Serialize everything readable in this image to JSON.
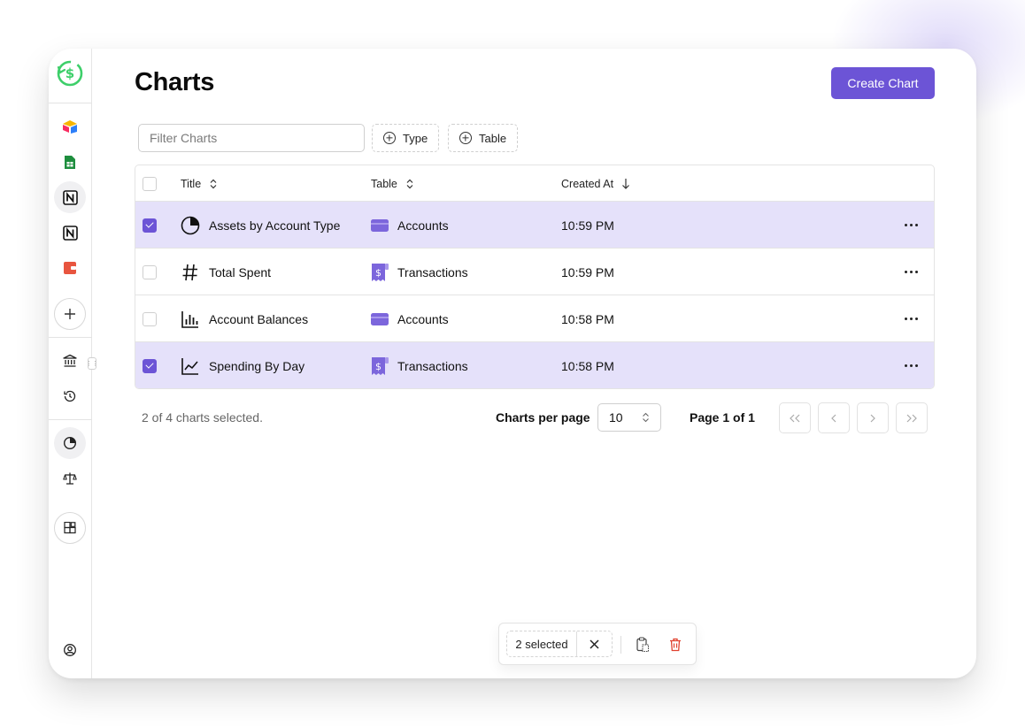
{
  "page": {
    "title": "Charts"
  },
  "toolbar": {
    "create_label": "Create Chart"
  },
  "filters": {
    "search_placeholder": "Filter Charts",
    "type_label": "Type",
    "table_label": "Table"
  },
  "table": {
    "headers": {
      "title": "Title",
      "table": "Table",
      "created_at": "Created At"
    },
    "rows": [
      {
        "title": "Assets by Account Type",
        "chart_icon": "pie-chart-icon",
        "table": "Accounts",
        "table_icon": "wallet-icon",
        "created": "10:59 PM",
        "selected": true
      },
      {
        "title": "Total Spent",
        "chart_icon": "hash-icon",
        "table": "Transactions",
        "table_icon": "receipt-icon",
        "created": "10:59 PM",
        "selected": false
      },
      {
        "title": "Account Balances",
        "chart_icon": "bar-chart-icon",
        "table": "Accounts",
        "table_icon": "wallet-icon",
        "created": "10:58 PM",
        "selected": false
      },
      {
        "title": "Spending By Day",
        "chart_icon": "line-chart-icon",
        "table": "Transactions",
        "table_icon": "receipt-icon",
        "created": "10:58 PM",
        "selected": true
      }
    ]
  },
  "pagination": {
    "selection_text": "2 of 4 charts selected.",
    "per_page_label": "Charts per page",
    "per_page_value": "10",
    "page_text": "Page 1 of 1"
  },
  "action_bar": {
    "selected_text": "2 selected"
  },
  "colors": {
    "accent": "#6c54d6",
    "selected_row": "#e5e1fa",
    "delete": "#e0412f"
  }
}
